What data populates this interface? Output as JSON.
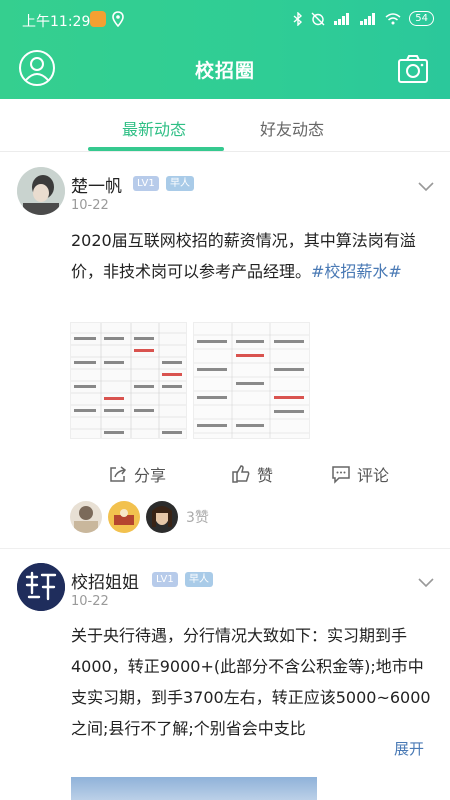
{
  "status_bar": {
    "time": "上午11:29",
    "battery": "54"
  },
  "header": {
    "title": "校招圈",
    "profile_icon": "user-circle-icon",
    "camera_icon": "camera-icon"
  },
  "tabs": [
    {
      "label": "最新动态",
      "active": true
    },
    {
      "label": "好友动态",
      "active": false
    }
  ],
  "posts": [
    {
      "author": "楚一帆",
      "level": "LV1",
      "badge": "早人",
      "date": "10-22",
      "text": "2020届互联网校招的薪资情况，其中算法岗有溢价，非技术岗可以参考产品经理。",
      "hashtag": "#校招薪水#",
      "actions": {
        "share": "分享",
        "like": "赞",
        "comment": "评论"
      },
      "like_count": "3赞"
    },
    {
      "author": "校招姐姐",
      "level": "LV1",
      "badge": "早人",
      "date": "10-22",
      "text": "关于央行待遇，分行情况大致如下：实习期到手4000，转正9000+(此部分不含公积金等);地市中支实习期，到手3700左右，转正应该5000~6000之间;县行不了解;个别省会中支比",
      "expand": "展开"
    }
  ],
  "colors": {
    "accent": "#2fbf85",
    "hashtag": "#4a7ab5"
  }
}
